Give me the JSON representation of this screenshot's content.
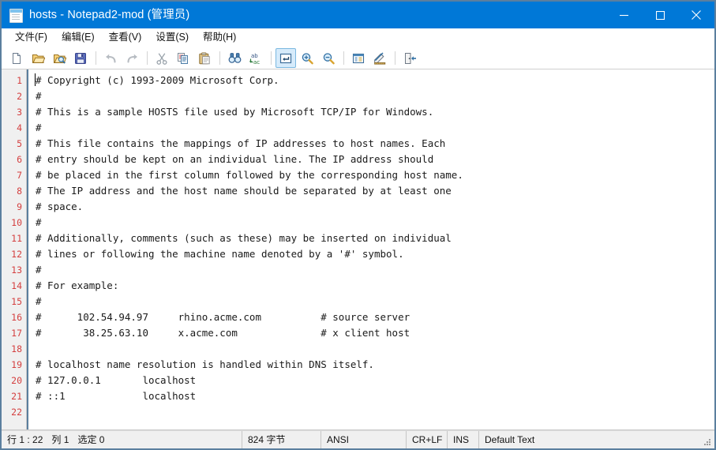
{
  "window": {
    "title_file": "hosts",
    "title_app": "Notepad2-mod",
    "title_admin": "(管理员)",
    "title_full": "hosts - Notepad2-mod (管理员)",
    "accent_color": "#0078D7",
    "border_color": "#5B7F9E",
    "icon": "notepad-icon",
    "controls": {
      "minimize": "minimize-icon",
      "maximize": "maximize-icon",
      "close": "close-icon"
    }
  },
  "menubar": {
    "items": [
      {
        "label": "文件(F)"
      },
      {
        "label": "编辑(E)"
      },
      {
        "label": "查看(V)"
      },
      {
        "label": "设置(S)"
      },
      {
        "label": "帮助(H)"
      }
    ]
  },
  "toolbar": {
    "buttons": [
      {
        "name": "new-file-icon",
        "tip": "新建",
        "active": false,
        "sep_after": false
      },
      {
        "name": "open-file-icon",
        "tip": "打开",
        "active": false,
        "sep_after": false
      },
      {
        "name": "browse-file-icon",
        "tip": "浏览",
        "active": false,
        "sep_after": false
      },
      {
        "name": "save-file-icon",
        "tip": "保存",
        "active": false,
        "sep_after": true
      },
      {
        "name": "undo-icon",
        "tip": "撤销",
        "active": false,
        "sep_after": false
      },
      {
        "name": "redo-icon",
        "tip": "重做",
        "active": false,
        "sep_after": true
      },
      {
        "name": "cut-icon",
        "tip": "剪切",
        "active": false,
        "sep_after": false
      },
      {
        "name": "copy-icon",
        "tip": "复制",
        "active": false,
        "sep_after": false
      },
      {
        "name": "paste-icon",
        "tip": "粘贴",
        "active": false,
        "sep_after": true
      },
      {
        "name": "find-icon",
        "tip": "查找",
        "active": false,
        "sep_after": false
      },
      {
        "name": "replace-icon",
        "tip": "替换",
        "active": false,
        "sep_after": true
      },
      {
        "name": "word-wrap-icon",
        "tip": "自动换行",
        "active": true,
        "sep_after": true
      },
      {
        "name": "zoom-in-icon",
        "tip": "放大",
        "active": false,
        "sep_after": false
      },
      {
        "name": "zoom-out-icon",
        "tip": "缩小",
        "active": false,
        "sep_after": true
      },
      {
        "name": "scheme-icon",
        "tip": "语法方案",
        "active": false,
        "sep_after": false
      },
      {
        "name": "edit-scheme-icon",
        "tip": "自定义方案",
        "active": false,
        "sep_after": true
      },
      {
        "name": "exit-icon",
        "tip": "退出",
        "active": false,
        "sep_after": false
      }
    ]
  },
  "editor": {
    "line_number_color": "#D43F3F",
    "gutter_color": "#F0F0F0",
    "text_color": "#1A1A1A",
    "caret_line": 1,
    "caret_column": 1,
    "lines": [
      {
        "n": "1",
        "text": "# Copyright (c) 1993-2009 Microsoft Corp."
      },
      {
        "n": "2",
        "text": "#"
      },
      {
        "n": "3",
        "text": "# This is a sample HOSTS file used by Microsoft TCP/IP for Windows."
      },
      {
        "n": "4",
        "text": "#"
      },
      {
        "n": "5",
        "text": "# This file contains the mappings of IP addresses to host names. Each"
      },
      {
        "n": "6",
        "text": "# entry should be kept on an individual line. The IP address should"
      },
      {
        "n": "7",
        "text": "# be placed in the first column followed by the corresponding host name."
      },
      {
        "n": "8",
        "text": "# The IP address and the host name should be separated by at least one"
      },
      {
        "n": "9",
        "text": "# space."
      },
      {
        "n": "10",
        "text": "#"
      },
      {
        "n": "11",
        "text": "# Additionally, comments (such as these) may be inserted on individual"
      },
      {
        "n": "12",
        "text": "# lines or following the machine name denoted by a '#' symbol."
      },
      {
        "n": "13",
        "text": "#"
      },
      {
        "n": "14",
        "text": "# For example:"
      },
      {
        "n": "15",
        "text": "#"
      },
      {
        "n": "16",
        "text": "#      102.54.94.97     rhino.acme.com          # source server"
      },
      {
        "n": "17",
        "text": "#       38.25.63.10     x.acme.com              # x client host"
      },
      {
        "n": "18",
        "text": ""
      },
      {
        "n": "19",
        "text": "# localhost name resolution is handled within DNS itself."
      },
      {
        "n": "20",
        "text": "# 127.0.0.1       localhost"
      },
      {
        "n": "21",
        "text": "# ::1             localhost"
      },
      {
        "n": "22",
        "text": ""
      }
    ]
  },
  "statusbar": {
    "line_label": "行",
    "line_value": "1 : 22",
    "col_label": "列",
    "col_value": "1",
    "sel_label": "选定",
    "sel_value": "0",
    "bytes": "824 字节",
    "encoding": "ANSI",
    "line_endings": "CR+LF",
    "insert_mode": "INS",
    "scheme": "Default Text"
  }
}
